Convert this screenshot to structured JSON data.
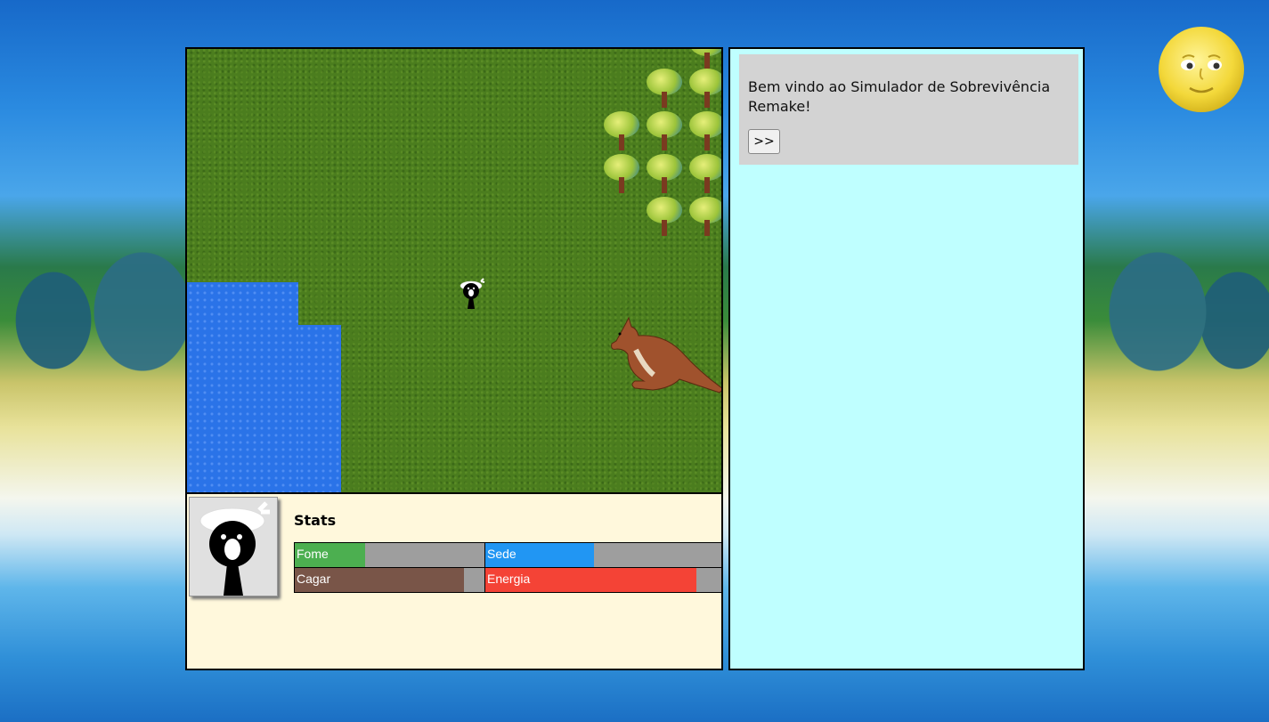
{
  "stats": {
    "title": "Stats",
    "bars": [
      {
        "label": "Fome",
        "value": 0.37,
        "color": "#4caf50"
      },
      {
        "label": "Sede",
        "value": 0.46,
        "color": "#2196f3"
      },
      {
        "label": "Cagar",
        "value": 0.89,
        "color": "#795548"
      },
      {
        "label": "Energia",
        "value": 0.89,
        "color": "#f44336"
      }
    ]
  },
  "messages": {
    "text": "Bem vindo ao Simulador de Sobrevivência Remake!",
    "next_label": ">>"
  },
  "icons": {
    "sky": "moon-icon",
    "player": "player-sprite",
    "animal": "kangaroo-sprite",
    "terrain": [
      "grass",
      "water",
      "tree"
    ]
  }
}
